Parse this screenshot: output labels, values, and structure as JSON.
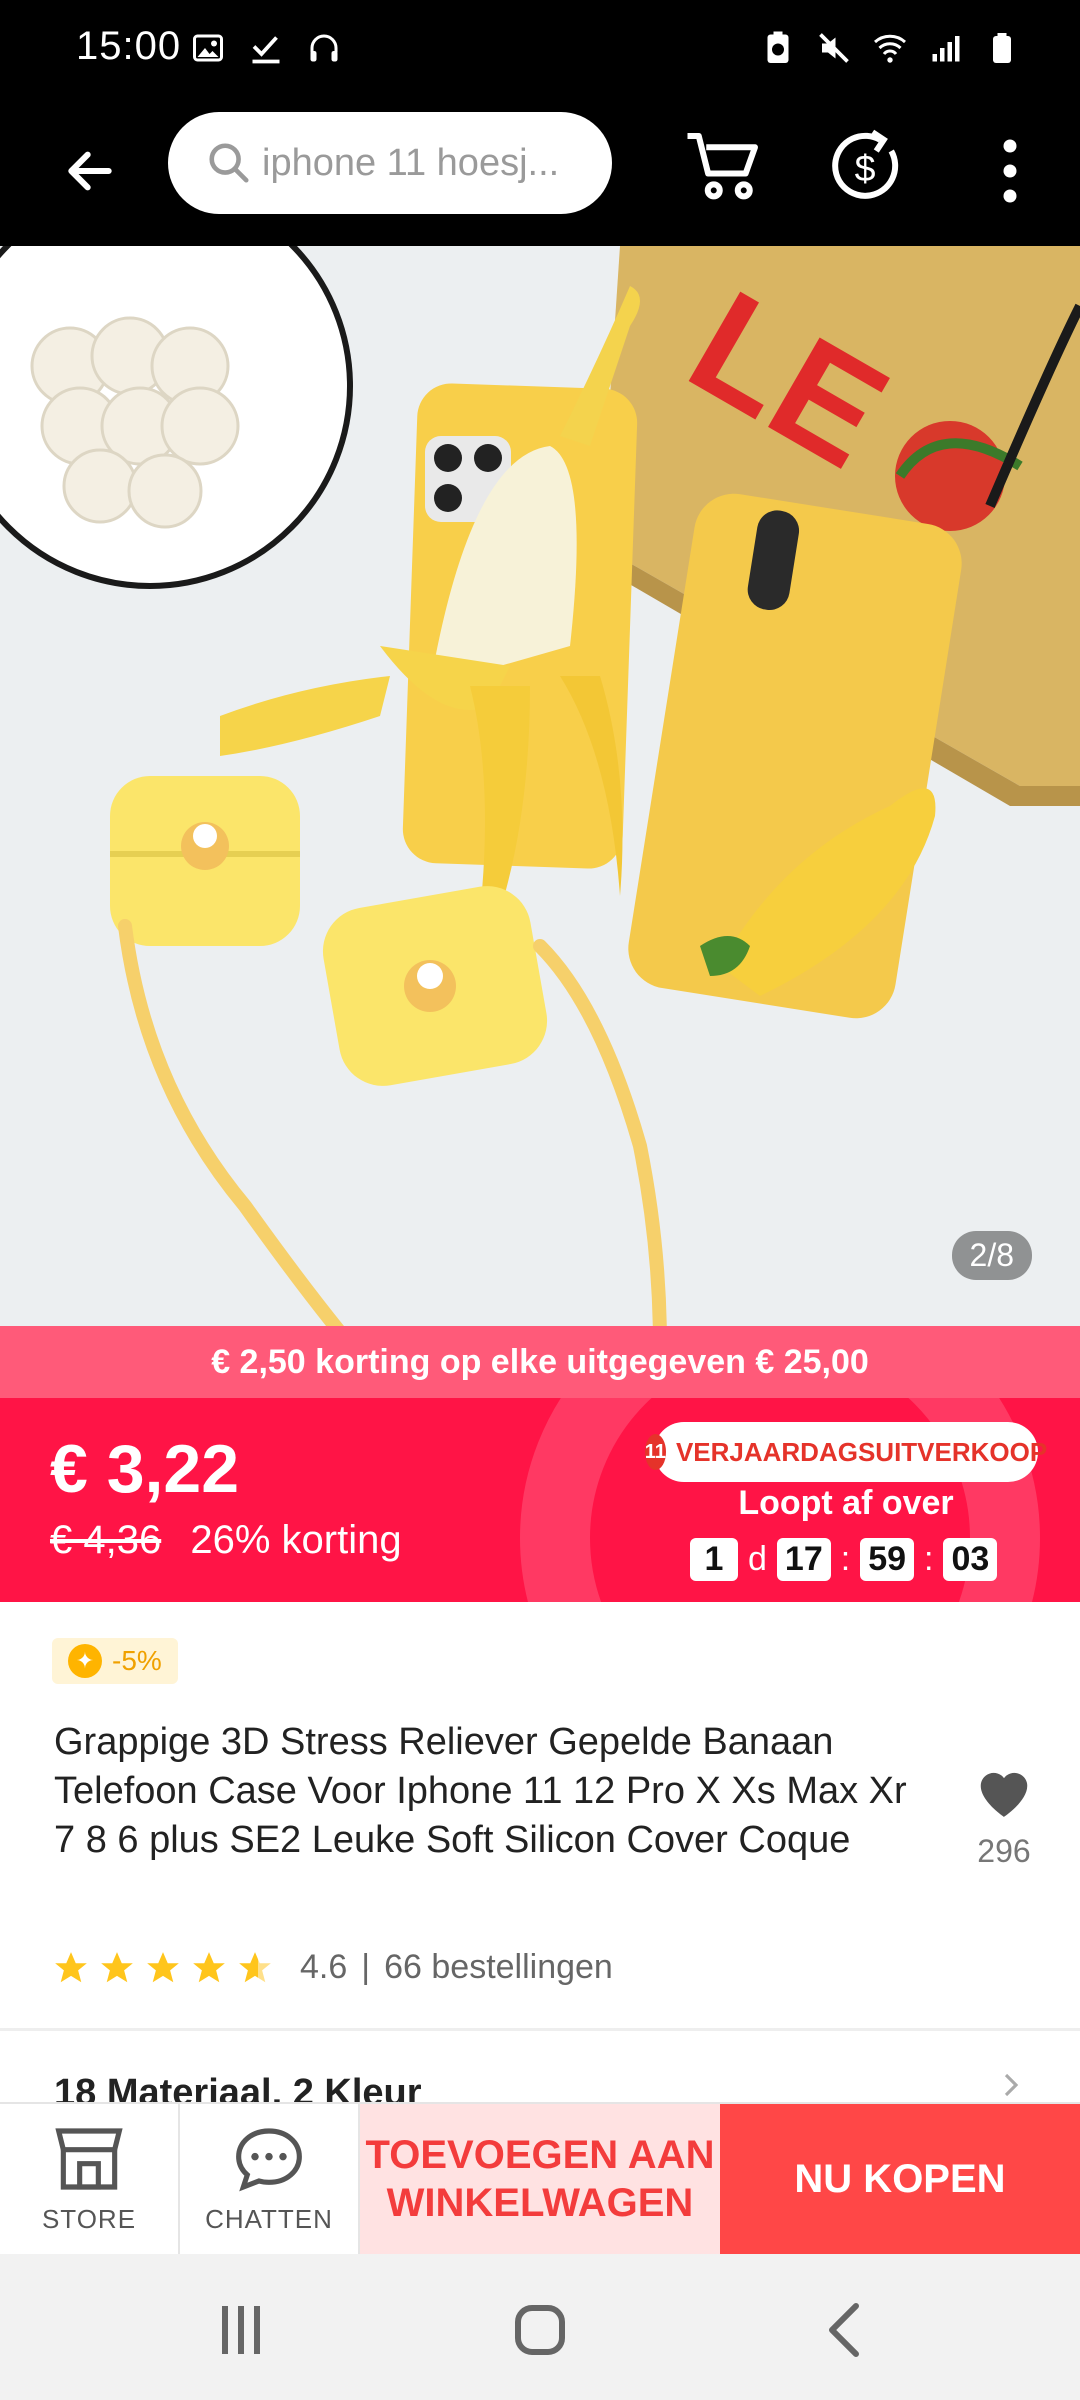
{
  "status_bar": {
    "time": "15:00",
    "left_icons": [
      "image-icon",
      "check-download-icon",
      "headphones-icon"
    ],
    "right_icons": [
      "battery-saver-icon",
      "mute-icon",
      "wifi-icon",
      "signal-icon",
      "battery-icon"
    ]
  },
  "header": {
    "search_text": "iphone 11 hoesj...",
    "icons": [
      "back-arrow-icon",
      "search-icon",
      "cart-icon",
      "coin-refresh-icon",
      "more-vertical-icon"
    ]
  },
  "gallery": {
    "counter": "2/8"
  },
  "promo": {
    "banner": "€ 2,50 korting op elke uitgegeven € 25,00"
  },
  "price": {
    "current": "€ 3,22",
    "original": "€ 4,36",
    "discount": "26% korting"
  },
  "sale_event": {
    "logo": "11",
    "badge": "VERJAARDAGSUITVERKOOP",
    "expires_label": "Loopt af over",
    "countdown": {
      "days": "1",
      "days_unit": "d",
      "hours": "17",
      "minutes": "59",
      "seconds": "03"
    }
  },
  "product": {
    "coin_discount": "-5%",
    "title": "Grappige 3D Stress Reliever Gepelde Banaan Telefoon Case Voor Iphone 11 12 Pro X Xs Max Xr 7 8 6 plus SE2 Leuke Soft Silicon Cover Coque",
    "wishlist_count": "296",
    "rating": 4.6,
    "rating_label": "4.6",
    "separator": "|",
    "orders": "66 bestellingen",
    "specs": "18 Materiaal, 2 Kleur"
  },
  "actions": {
    "store_label": "STORE",
    "chat_label": "CHATTEN",
    "add_to_cart": "TOEVOEGEN AAN WINKELWAGEN",
    "buy_now": "NU KOPEN"
  },
  "colors": {
    "accent": "#ff1446",
    "promo": "#ff5a79",
    "buy_now": "#ff4747",
    "add_cart_bg": "#ffe2e2",
    "star": "#ffc51c"
  }
}
